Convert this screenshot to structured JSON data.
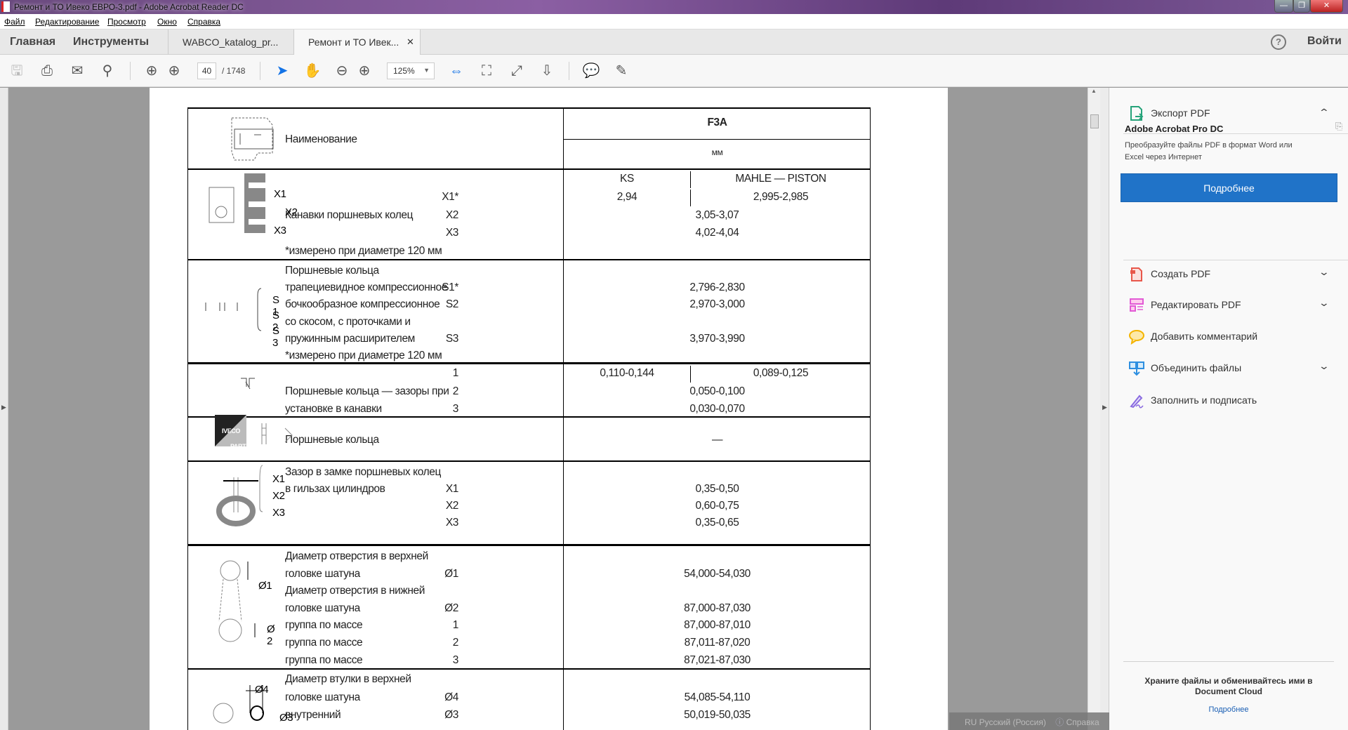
{
  "window": {
    "title": "Ремонт и ТО Ивеко ЕВРО-3.pdf - Adobe Acrobat Reader DC"
  },
  "menu": [
    "Файл",
    "Редактирование",
    "Просмотр",
    "Окно",
    "Справка"
  ],
  "tabs": {
    "home": "Главная",
    "tools": "Инструменты",
    "doc1": "WABCO_katalog_pr...",
    "doc2": "Ремонт и ТО Ивек...",
    "help": "?",
    "signin": "Войти"
  },
  "toolbar": {
    "page": "40",
    "total": "/ 1748",
    "zoom": "125%"
  },
  "table": {
    "header": {
      "name": "Наименование",
      "model": "F3A",
      "unit": "мм"
    },
    "rows": [
      {
        "lines": [
          {
            "ks": "KS",
            "mahle": "MAHLE — PISTON"
          },
          {
            "mark": "X1*",
            "ks": "2,94",
            "mahle": "2,995-2,985"
          },
          {
            "name": "Канавки поршневых колец",
            "mark": "X2",
            "value": "3,05-3,07"
          },
          {
            "mark": "X3",
            "value": "4,02-4,04"
          },
          {
            "name": "*измерено при диаметре 120 мм"
          }
        ],
        "icon_labels": [
          "X1",
          "X2",
          "X3"
        ]
      },
      {
        "lines": [
          {
            "name": "Поршневые кольца"
          },
          {
            "name": "трапециевидное компрессионное",
            "mark": "S1*",
            "value": "2,796-2,830"
          },
          {
            "name": "бочкообразное компрессионное",
            "mark": "S2",
            "value": "2,970-3,000"
          },
          {
            "name": "со скосом, с проточками и"
          },
          {
            "name": "пружинным расширителем",
            "mark": "S3",
            "value": "3,970-3,990"
          },
          {
            "name": "*измерено при диаметре 120 мм"
          }
        ],
        "icon_labels": [
          "S 1",
          "S 2",
          "S 3"
        ]
      },
      {
        "lines": [
          {
            "mark": "1",
            "ks": "0,110-0,144",
            "mahle": "0,089-0,125"
          },
          {
            "name": "Поршневые кольца — зазоры при",
            "mark": "2",
            "value": "0,050-0,100"
          },
          {
            "name": "установке в канавки",
            "mark": "3",
            "value": "0,030-0,070"
          }
        ]
      },
      {
        "lines": [
          {
            "name": "Поршневые кольца",
            "value": "—"
          }
        ],
        "icon_labels": [
          "IVECO",
          "PARTS"
        ]
      },
      {
        "lines": [
          {
            "name": "Зазор в замке поршневых колец"
          },
          {
            "name": "в гильзах цилиндров",
            "mark": "X1",
            "value": "0,35-0,50"
          },
          {
            "mark": "X2",
            "value": "0,60-0,75"
          },
          {
            "mark": "X3",
            "value": "0,35-0,65"
          }
        ],
        "icon_labels": [
          "X1",
          "X2",
          "X3"
        ]
      },
      {
        "lines": [
          {
            "name": "Диаметр отверстия в верхней"
          },
          {
            "name": "головке шатуна",
            "mark": "Ø1",
            "value": "54,000-54,030"
          },
          {
            "name": "Диаметр отверстия в нижней"
          },
          {
            "name": "головке шатуна",
            "mark": "Ø2",
            "value": "87,000-87,030"
          },
          {
            "name": "группа по массе",
            "mark": "1",
            "value": "87,000-87,010"
          },
          {
            "name": "группа по массе",
            "mark": "2",
            "value": "87,011-87,020"
          },
          {
            "name": "группа по массе",
            "mark": "3",
            "value": "87,021-87,030"
          }
        ],
        "icon_labels": [
          "Ø1",
          "Ø 2"
        ]
      },
      {
        "lines": [
          {
            "name": "Диаметр втулки в верхней"
          },
          {
            "name": "головке шатуна",
            "mark": "Ø4",
            "value": "54,085-54,110"
          },
          {
            "name": "внутренний",
            "mark": "Ø3",
            "value": "50,019-50,035"
          }
        ],
        "icon_labels": [
          "Ø4",
          "Ø3"
        ]
      }
    ]
  },
  "right_pane": {
    "export": "Экспорт PDF",
    "promo_title": "Adobe Acrobat Pro DC",
    "promo_text": "Преобразуйте файлы PDF в формат Word или Excel через Интернет",
    "promo_button": "Подробнее",
    "items": [
      {
        "label": "Создать PDF",
        "color": "#e8574a"
      },
      {
        "label": "Редактировать PDF",
        "color": "#e25ad5"
      },
      {
        "label": "Добавить комментарий",
        "color": "#f4b400"
      },
      {
        "label": "Объединить файлы",
        "color": "#2d8fe0"
      },
      {
        "label": "Заполнить и подписать",
        "color": "#8a6be0"
      }
    ],
    "cloud_text": "Храните файлы и обменивайтесь ими в Document Cloud",
    "cloud_link": "Подробнее"
  },
  "langbar": {
    "lang": "RU Русский (Россия)",
    "help": "Справка"
  }
}
